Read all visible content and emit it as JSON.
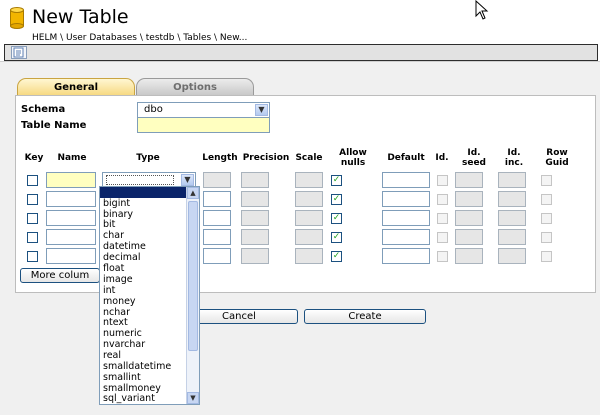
{
  "app": {
    "title": "New Table",
    "breadcrumb": "HELM \\ User Databases \\ testdb \\ Tables \\ New..."
  },
  "tabs": [
    "General",
    "Options"
  ],
  "form": {
    "schema_label": "Schema",
    "schema_value": "dbo",
    "table_name_label": "Table Name",
    "table_name_value": ""
  },
  "columns_header": {
    "key": "Key",
    "name": "Name",
    "type": "Type",
    "length": "Length",
    "precision": "Precision",
    "scale": "Scale",
    "allow_nulls": [
      "Allow",
      "nulls"
    ],
    "default": "Default",
    "id": "Id.",
    "id_seed": [
      "Id.",
      "seed"
    ],
    "id_inc": [
      "Id.",
      "inc."
    ],
    "row_guid": [
      "Row",
      "Guid"
    ]
  },
  "rows": [
    {
      "key": false,
      "allow_nulls": true
    },
    {
      "key": false,
      "allow_nulls": true
    },
    {
      "key": false,
      "allow_nulls": true
    },
    {
      "key": false,
      "allow_nulls": true
    },
    {
      "key": false,
      "allow_nulls": true
    }
  ],
  "buttons": {
    "more_columns": "More colum",
    "cancel": "Cancel",
    "create": "Create"
  },
  "type_dropdown": {
    "selected": "",
    "options": [
      "bigint",
      "binary",
      "bit",
      "char",
      "datetime",
      "decimal",
      "float",
      "image",
      "int",
      "money",
      "nchar",
      "ntext",
      "numeric",
      "nvarchar",
      "real",
      "smalldatetime",
      "smallint",
      "smallmoney",
      "sql_variant"
    ]
  },
  "icons": {
    "app": "database-icon",
    "cursor": "mouse-pointer-icon",
    "toolbar": "script-icon",
    "check": "checkmark-icon",
    "chevron": "chevron-down-icon"
  },
  "colors": {
    "accent_tab": "#f6d77e",
    "input_border": "#7f9db9",
    "required_field": "#ffffc0",
    "dropdown_selection": "#0a246a",
    "check": "#21a121"
  }
}
